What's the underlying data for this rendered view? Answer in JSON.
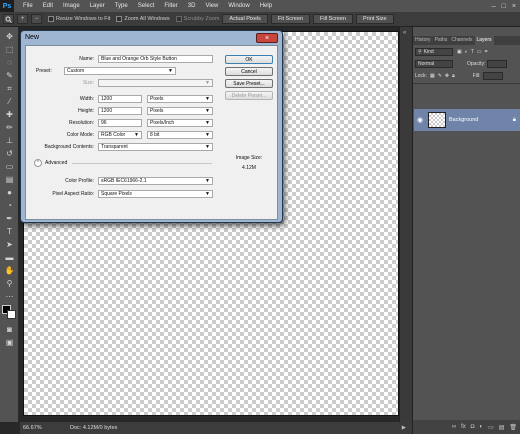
{
  "app": {
    "logo": "Ps"
  },
  "menubar": {
    "items": [
      "File",
      "Edit",
      "Image",
      "Layer",
      "Type",
      "Select",
      "Filter",
      "3D",
      "View",
      "Window",
      "Help"
    ],
    "window_controls": [
      "–",
      "□",
      "×"
    ]
  },
  "options_bar": {
    "resize_windows_label": "Resize Windows to Fit",
    "zoom_all_label": "Zoom All Windows",
    "scrubby_zoom_label": "Scrubby Zoom",
    "buttons": [
      "Actual Pixels",
      "Fit Screen",
      "Fill Screen",
      "Print Size"
    ]
  },
  "dialog": {
    "title": "New",
    "close_glyph": "×",
    "name_label": "Name:",
    "name_value": "Blue and Orange Orb Style Button",
    "preset_label": "Preset:",
    "preset_value": "Custom",
    "size_label": "Size:",
    "width_label": "Width:",
    "width_value": "1200",
    "width_unit": "Pixels",
    "height_label": "Height:",
    "height_value": "1200",
    "height_unit": "Pixels",
    "resolution_label": "Resolution:",
    "resolution_value": "96",
    "resolution_unit": "Pixels/Inch",
    "color_mode_label": "Color Mode:",
    "color_mode_value": "RGB Color",
    "bit_depth_value": "8 bit",
    "background_label": "Background Contents:",
    "background_value": "Transparent",
    "advanced_label": "Advanced",
    "advanced_glyph": "⌃",
    "color_profile_label": "Color Profile:",
    "color_profile_value": "sRGB IEC61966-2.1",
    "pixel_aspect_label": "Pixel Aspect Ratio:",
    "pixel_aspect_value": "Square Pixels",
    "image_size_label": "Image Size:",
    "image_size_value": "4.12M",
    "buttons": {
      "ok": "OK",
      "cancel": "Cancel",
      "save_preset": "Save Preset...",
      "delete_preset": "Delete Preset..."
    }
  },
  "status": {
    "zoom": "66.67%",
    "doc": "Doc: 4.12M/0 bytes"
  },
  "panel": {
    "tabs": [
      "History",
      "Paths",
      "Channels",
      "Layers"
    ],
    "active_tab": "Layers",
    "kind_label": "Kind",
    "blend_mode": "Normal",
    "opacity_label": "Opacity:",
    "lock_label": "Lock:",
    "fill_label": "Fill:",
    "layer_name": "Background",
    "footer_icons": [
      "∞",
      "fx",
      "◘",
      "◐",
      "▭",
      "▤",
      "🗑"
    ]
  },
  "colors": {
    "accent": "#31a8ff",
    "layer_selected": "#6f84a8",
    "dialog_frame": "#9fb6d2"
  }
}
